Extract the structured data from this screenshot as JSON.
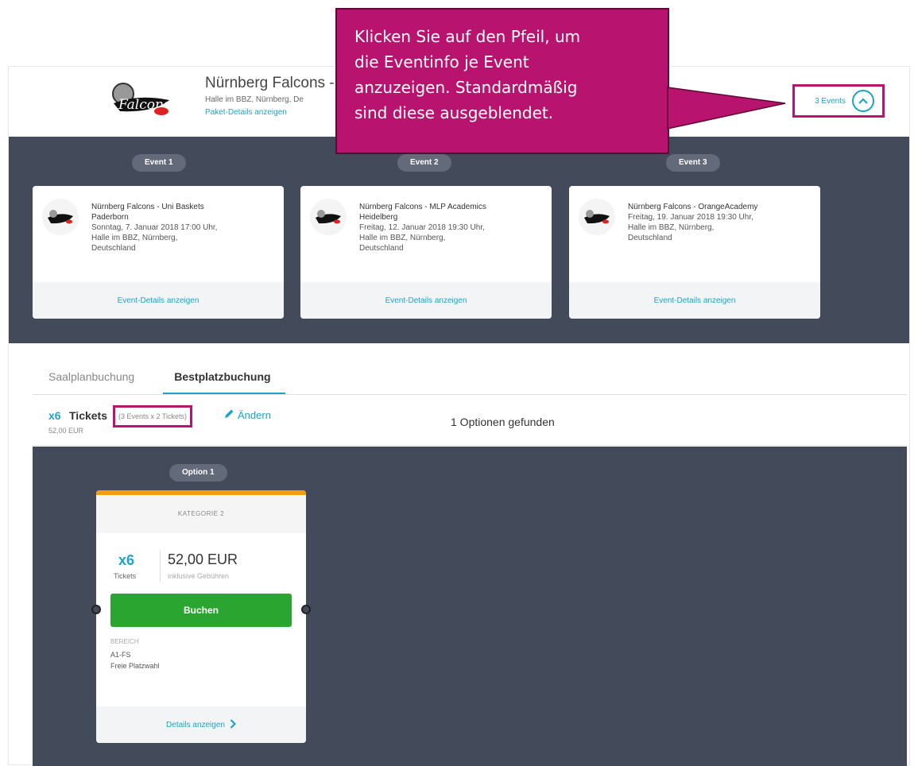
{
  "package": {
    "title": "Nürnberg Falcons - 3",
    "location": "Halle im BBZ, Nürnberg, De",
    "details_link": "Paket-Details anzeigen",
    "events_count_label": "3 Events"
  },
  "events": [
    {
      "pill": "Event 1",
      "name_line1": "Nürnberg Falcons - Uni Baskets",
      "name_line2": "Paderborn",
      "date": "Sonntag, 7. Januar 2018 17:00 Uhr,",
      "venue_line1": "Halle im BBZ, Nürnberg,",
      "venue_line2": "Deutschland",
      "link": "Event-Details anzeigen"
    },
    {
      "pill": "Event 2",
      "name_line1": "Nürnberg Falcons - MLP Academics",
      "name_line2": "Heidelberg",
      "date": "Freitag, 12. Januar 2018 19:30 Uhr,",
      "venue_line1": "Halle im BBZ, Nürnberg,",
      "venue_line2": "Deutschland",
      "link": "Event-Details anzeigen"
    },
    {
      "pill": "Event 3",
      "name_line1": "Nürnberg Falcons - OrangeAcademy",
      "name_line2": "",
      "date": "Freitag, 19. Januar 2018 19:30 Uhr,",
      "venue_line1": "Halle im BBZ, Nürnberg,",
      "venue_line2": "Deutschland",
      "link": "Event-Details anzeigen"
    }
  ],
  "tabs": {
    "seatmap": "Saalplanbuchung",
    "bestseat": "Bestplatzbuchung"
  },
  "ticket_bar": {
    "qty": "x6",
    "tickets_label": "Tickets",
    "breakdown": "(3 Events x 2 Tickets)",
    "edit": "Ändern",
    "price": "52,00 EUR",
    "found": "1 Optionen gefunden"
  },
  "option": {
    "pill": "Option 1",
    "category": "KATEGORIE 2",
    "qty": "x6",
    "tickets_label": "Tickets",
    "price": "52,00 EUR",
    "fee_note": "inklusive Gebühren",
    "buy": "Buchen",
    "area_label": "BEREICH",
    "area_line1": "A1-FS",
    "area_line2": "Freie Platzwahl",
    "details": "Details anzeigen"
  },
  "callout": {
    "line1": "Klicken Sie auf den Pfeil, um",
    "line2": "die Eventinfo je Event",
    "line3": "anzuzeigen. Standardmäßig",
    "line4": "sind diese ausgeblendet."
  },
  "colors": {
    "accent": "#1ea2c8",
    "annotation": "#b8136e",
    "dark_band": "#434a59",
    "buy_button": "#2aa52f",
    "option_topbar": "#f39c12"
  }
}
